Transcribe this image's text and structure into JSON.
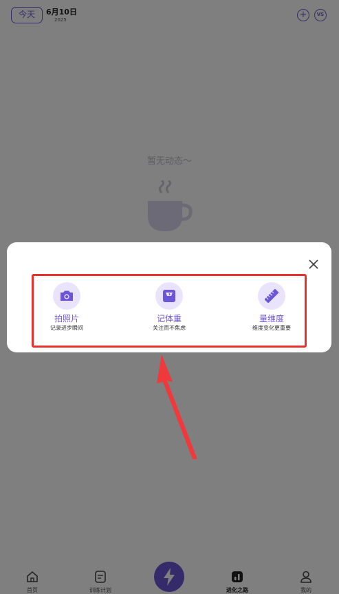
{
  "header": {
    "today_label": "今天",
    "date": "6月10日",
    "year": "2025",
    "add_symbol": "+",
    "vs_label": "VS"
  },
  "feed": {
    "empty_text": "暂无动态～"
  },
  "modal": {
    "options": [
      {
        "title": "拍照片",
        "subtitle": "记录进步瞬间",
        "icon": "camera-icon"
      },
      {
        "title": "记体重",
        "subtitle": "关注而不焦虑",
        "icon": "scale-icon"
      },
      {
        "title": "量维度",
        "subtitle": "维度变化更重要",
        "icon": "ruler-icon"
      }
    ]
  },
  "bottom_nav": {
    "items": [
      {
        "label": "首页",
        "icon": "home-icon"
      },
      {
        "label": "训练计划",
        "icon": "plan-icon"
      },
      {
        "label": "进化之路",
        "icon": "chart-icon"
      },
      {
        "label": "我的",
        "icon": "profile-icon"
      }
    ]
  },
  "colors": {
    "accent": "#6a56d6",
    "highlight": "#e8302f",
    "overlay": "rgba(0,0,0,0.5)"
  }
}
